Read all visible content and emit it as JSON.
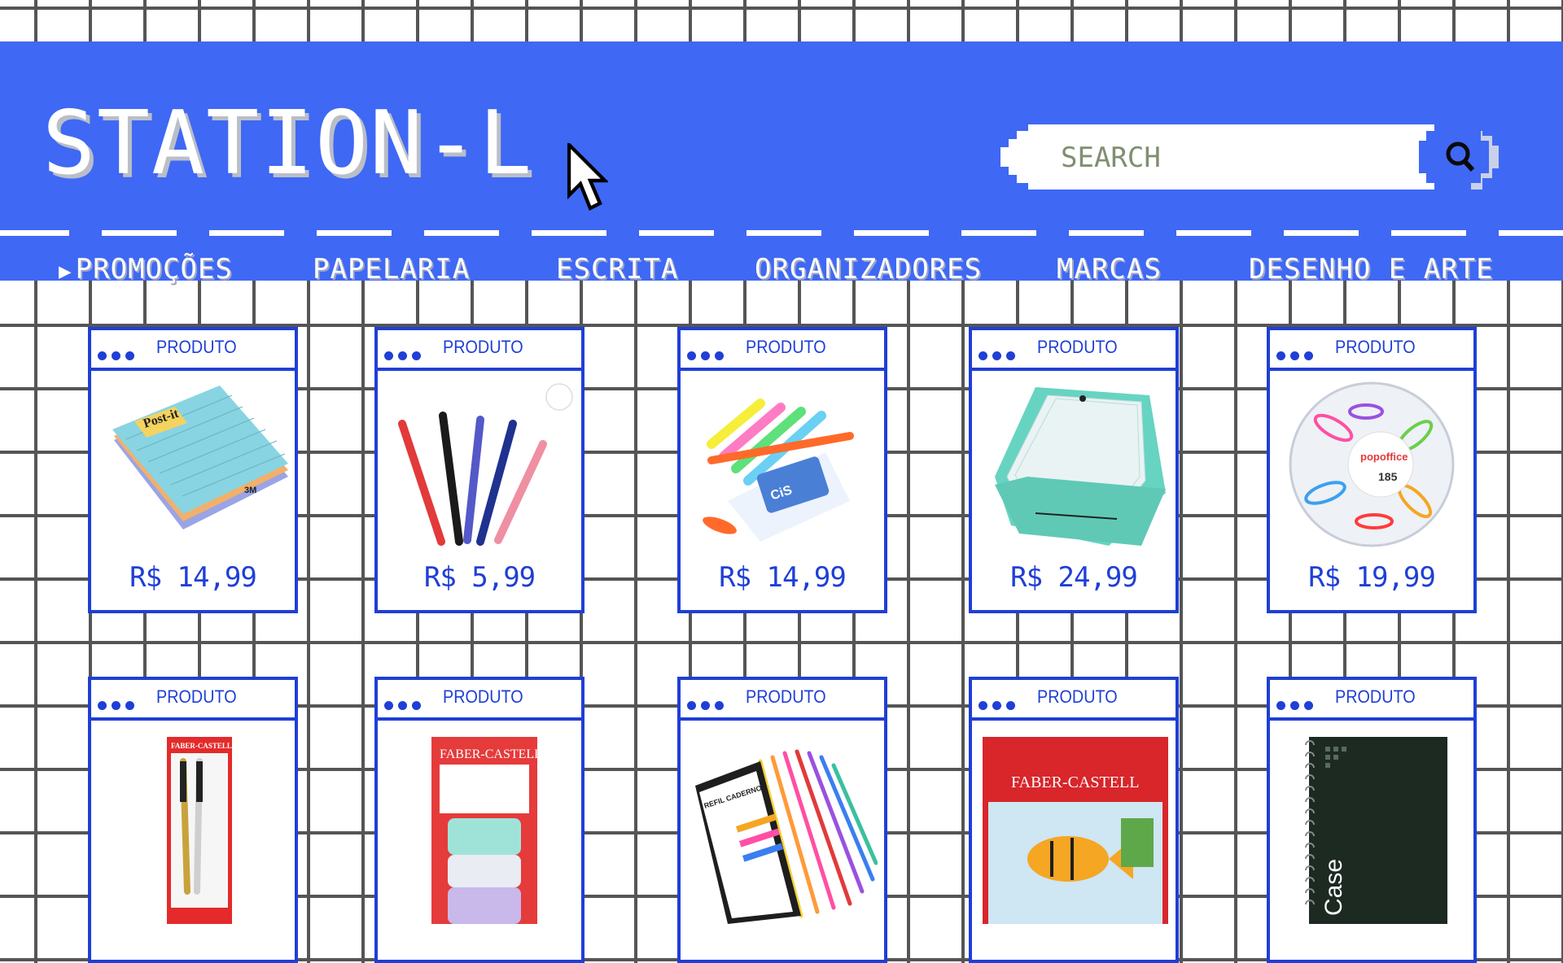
{
  "brand": {
    "logo": "STATION-L"
  },
  "search": {
    "placeholder": "SEARCH"
  },
  "nav": {
    "items": [
      {
        "label": "PROMOÇÕES",
        "active": true
      },
      {
        "label": "PAPELARIA"
      },
      {
        "label": "ESCRITA"
      },
      {
        "label": "ORGANIZADORES"
      },
      {
        "label": "MARCAS"
      },
      {
        "label": "DESENHO E ARTE"
      }
    ]
  },
  "products": [
    {
      "tag": "PRODUTO",
      "price": "R$ 14,99",
      "image": "sticky-notes",
      "brand_text": "Post-it"
    },
    {
      "tag": "PRODUTO",
      "price": "R$ 5,99",
      "image": "pens"
    },
    {
      "tag": "PRODUTO",
      "price": "R$ 14,99",
      "image": "highlighters",
      "brand_text": "CiS"
    },
    {
      "tag": "PRODUTO",
      "price": "R$ 24,99",
      "image": "expanding-file-folder"
    },
    {
      "tag": "PRODUTO",
      "price": "R$ 19,99",
      "image": "clips-container",
      "brand_text": "popoffice"
    },
    {
      "tag": "PRODUTO",
      "image": "faber-castell-pens",
      "brand_text": "FABER-CASTELL"
    },
    {
      "tag": "PRODUTO",
      "image": "faber-castell-eraser",
      "brand_text": "FABER-CASTELL"
    },
    {
      "tag": "PRODUTO",
      "image": "binder-dividers",
      "brand_text": "REFIL CADERNO"
    },
    {
      "tag": "PRODUTO",
      "image": "faber-castell-watercolor",
      "brand_text": "FABER-CASTELL"
    },
    {
      "tag": "PRODUTO",
      "image": "spiral-notebook",
      "brand_text": "Case"
    }
  ],
  "colors": {
    "brand_blue": "#3f68f4",
    "card_border": "#1f3fd6",
    "grid": "#555555"
  }
}
